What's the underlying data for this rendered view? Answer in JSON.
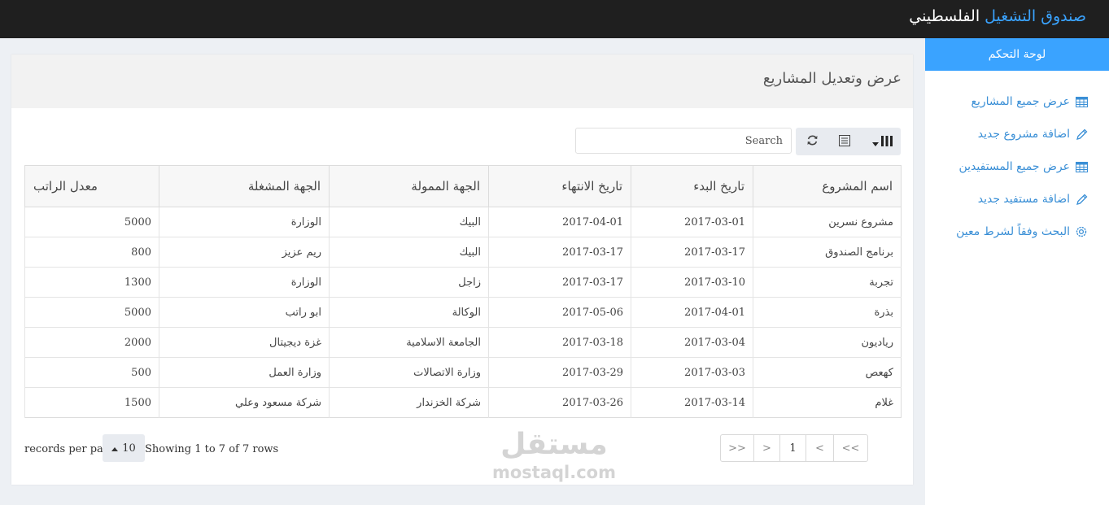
{
  "app": {
    "brand_part1": "صندوق التشغيل",
    "brand_part2": "الفلسطيني"
  },
  "sidebar": {
    "header": "لوحة التحكم",
    "items": [
      {
        "label": "عرض جميع المشاريع",
        "icon": "table-icon"
      },
      {
        "label": "اضافة مشروع جديد",
        "icon": "pencil-icon"
      },
      {
        "label": "عرض جميع المستفيدين",
        "icon": "table-icon"
      },
      {
        "label": "اضافة مستفيد جديد",
        "icon": "pencil-icon"
      },
      {
        "label": "البحث وفقاً لشرط معين",
        "icon": "gear-icon"
      }
    ]
  },
  "main": {
    "title": "عرض وتعديل المشاريع",
    "search_placeholder": "Search",
    "toolbar": {
      "columns_icon": "columns-icon",
      "list_icon": "list-icon",
      "refresh_icon": "refresh-icon"
    }
  },
  "table": {
    "columns": [
      "اسم المشروع",
      "تاريخ البدء",
      "تاريخ الانتهاء",
      "الجهة الممولة",
      "الجهة المشغلة",
      "معدل الراتب"
    ],
    "rows": [
      [
        "مشروع نسرين",
        "2017-03-01",
        "2017-04-01",
        "البيك",
        "الوزارة",
        "5000"
      ],
      [
        "برنامج الصندوق",
        "2017-03-17",
        "2017-03-17",
        "البيك",
        "ريم عزيز",
        "800"
      ],
      [
        "تجربة",
        "2017-03-10",
        "2017-03-17",
        "زاجل",
        "الوزارة",
        "1300"
      ],
      [
        "بذرة",
        "2017-04-01",
        "2017-05-06",
        "الوكالة",
        "ابو راتب",
        "5000"
      ],
      [
        "رياديون",
        "2017-03-04",
        "2017-03-18",
        "الجامعة الاسلامية",
        "غزة ديجيتال",
        "2000"
      ],
      [
        "كهعص",
        "2017-03-03",
        "2017-03-29",
        "وزارة الاتصالات",
        "وزارة العمل",
        "500"
      ],
      [
        "غلام",
        "2017-03-14",
        "2017-03-26",
        "شركة الخزندار",
        "شركة مسعود وعلي",
        "1500"
      ]
    ]
  },
  "footer": {
    "records_per_page": "records per page",
    "page_size": "10",
    "showing": "Showing 1 to 7 of 7 rows",
    "pagination": [
      ">>",
      ">",
      "1",
      "<",
      "<<"
    ]
  },
  "watermark": {
    "arabic": "مستقل",
    "latin": "mostaql.com"
  },
  "colors": {
    "accent": "#3aa3ff",
    "link": "#3a8fd6",
    "topbar": "#1f1f1f"
  }
}
